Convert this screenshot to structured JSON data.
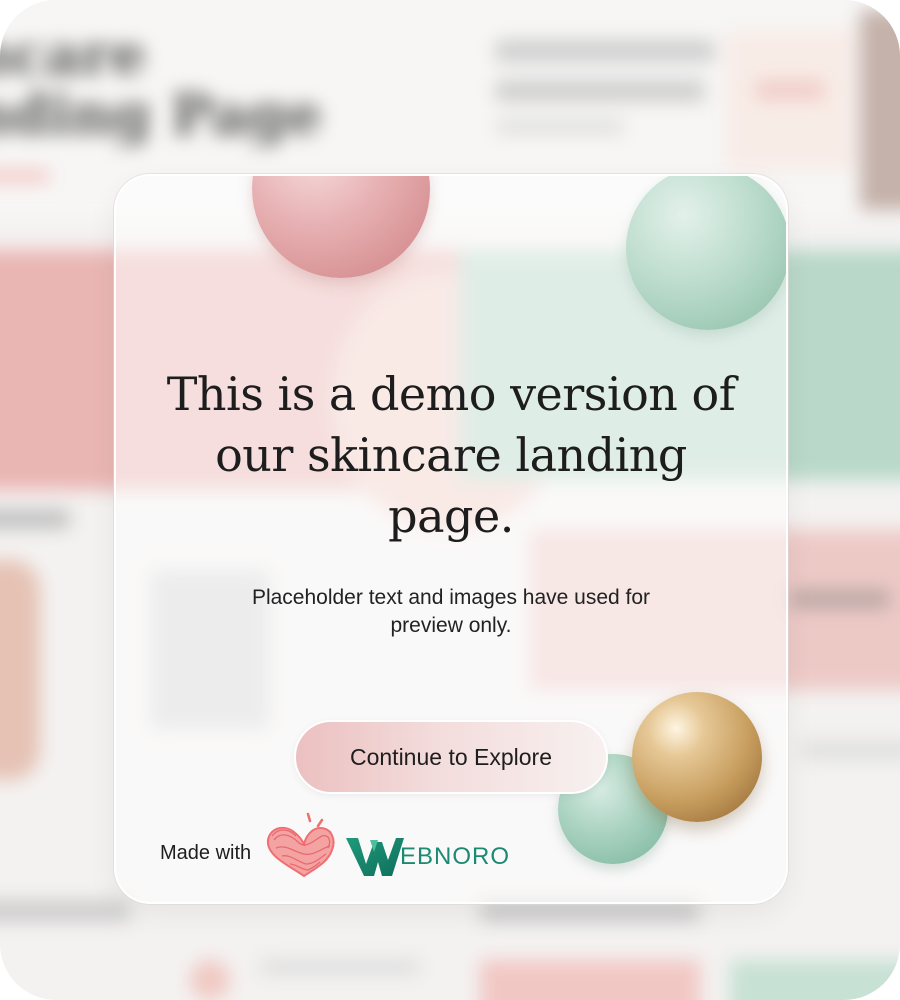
{
  "backdrop": {
    "hero_line_1": "ncare",
    "hero_line_2": "nding Page"
  },
  "modal": {
    "title": "This is a demo version of our skincare landing page.",
    "subtitle": "Placeholder text and images have used for preview only.",
    "continue_label": "Continue to Explore",
    "made_with_label": "Made with",
    "brand_initial": "W",
    "brand_rest": "EBNORO"
  },
  "colors": {
    "pink_accent": "#e8b3b5",
    "mint_accent": "#a9d2c0",
    "gold_accent": "#c79d5e",
    "brand_green": "#1c8a72",
    "heart_red": "#f06e6e"
  },
  "icons": {
    "heart": "heart-icon",
    "brand": "webnoro-logo"
  }
}
